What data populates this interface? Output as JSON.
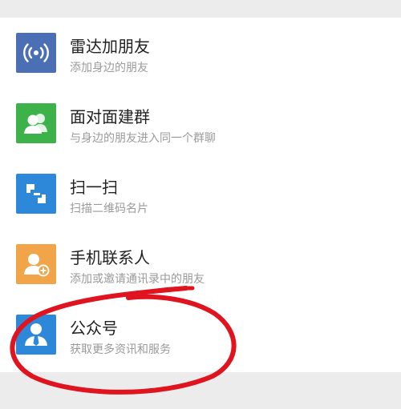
{
  "items": [
    {
      "title": "雷达加朋友",
      "subtitle": "添加身边的朋友",
      "icon": "radar-icon",
      "color": "#4a6fb5"
    },
    {
      "title": "面对面建群",
      "subtitle": "与身边的朋友进入同一个群聊",
      "icon": "group-icon",
      "color": "#3db24a"
    },
    {
      "title": "扫一扫",
      "subtitle": "扫描二维码名片",
      "icon": "scan-icon",
      "color": "#2e88d9"
    },
    {
      "title": "手机联系人",
      "subtitle": "添加或邀请通讯录中的朋友",
      "icon": "contact-add-icon",
      "color": "#f2a548"
    },
    {
      "title": "公众号",
      "subtitle": "获取更多资讯和服务",
      "icon": "official-account-icon",
      "color": "#2e88d9"
    }
  ],
  "colors": {
    "background": "#ececec",
    "list_background": "#ffffff",
    "title_text": "#222222",
    "subtitle_text": "#9a9a9a",
    "annotation": "#e0141e"
  }
}
